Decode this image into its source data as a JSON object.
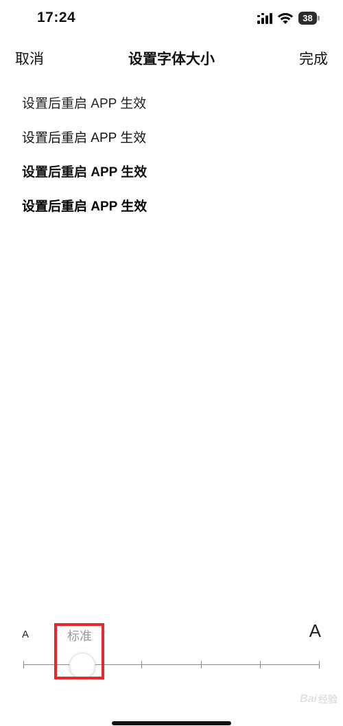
{
  "status_bar": {
    "time": "17:24",
    "battery_level": "38",
    "icons": [
      "signal-icon",
      "wifi-icon",
      "battery-icon"
    ]
  },
  "nav": {
    "cancel_label": "取消",
    "title": "设置字体大小",
    "done_label": "完成"
  },
  "preview": {
    "lines": [
      "设置后重启 APP 生效",
      "设置后重启 APP 生效",
      "设置后重启 APP 生效",
      "设置后重启 APP 生效"
    ]
  },
  "font_slider": {
    "small_label": "A",
    "large_label": "A",
    "current_label": "标准",
    "steps": 6,
    "selected_step": 1,
    "highlight_color": "#e8282b"
  },
  "watermark": {
    "text": "Bai",
    "sub": "经验"
  }
}
